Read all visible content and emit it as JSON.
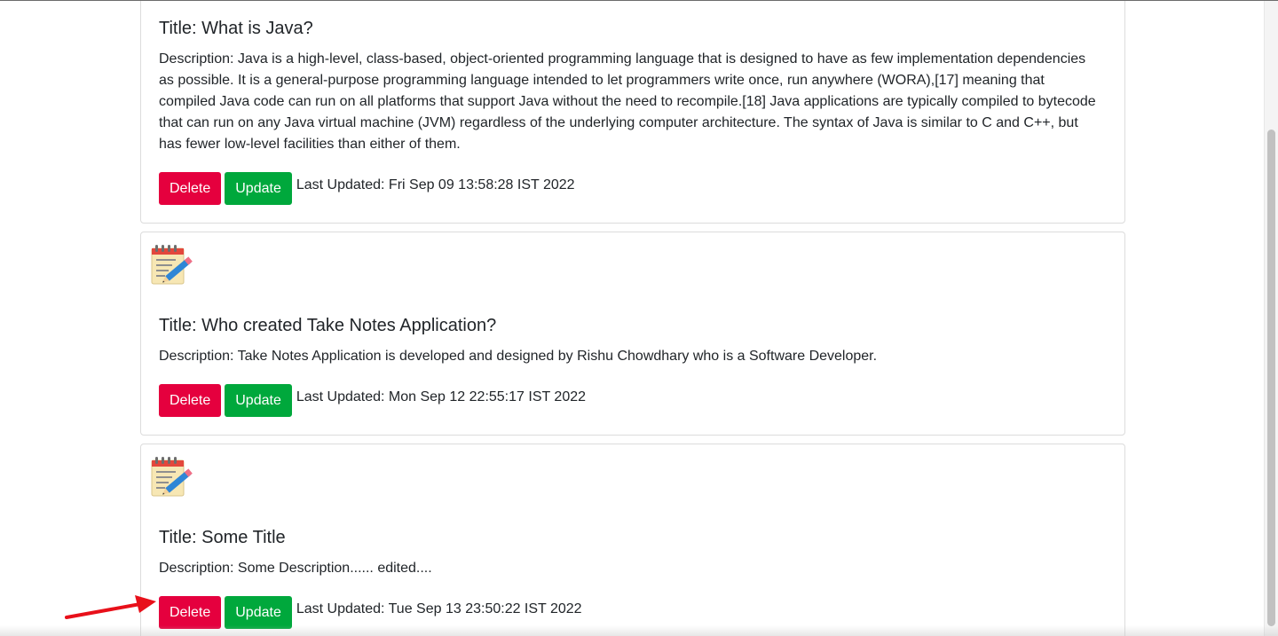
{
  "notes": [
    {
      "title": "Title: What is Java?",
      "description": "Description: Java is a high-level, class-based, object-oriented programming language that is designed to have as few implementation dependencies as possible. It is a general-purpose programming language intended to let programmers write once, run anywhere (WORA),[17] meaning that compiled Java code can run on all platforms that support Java without the need to recompile.[18] Java applications are typically compiled to bytecode that can run on any Java virtual machine (JVM) regardless of the underlying computer architecture. The syntax of Java is similar to C and C++, but has fewer low-level facilities than either of them.",
      "delete_label": "Delete",
      "update_label": "Update",
      "last_updated": "Last Updated: Fri Sep 09 13:58:28 IST 2022"
    },
    {
      "icon": "notepad-pencil-icon",
      "title": "Title: Who created Take Notes Application?",
      "description": "Description: Take Notes Application is developed and designed by Rishu Chowdhary who is a Software Developer.",
      "delete_label": "Delete",
      "update_label": "Update",
      "last_updated": "Last Updated: Mon Sep 12 22:55:17 IST 2022"
    },
    {
      "icon": "notepad-pencil-icon",
      "title": "Title: Some Title",
      "description": "Description: Some Description...... edited....",
      "delete_label": "Delete",
      "update_label": "Update",
      "last_updated": "Last Updated: Tue Sep 13 23:50:22 IST 2022"
    }
  ],
  "colors": {
    "delete_button": "#e5003e",
    "update_button": "#00a83c",
    "annotation_arrow": "#e8101a"
  }
}
